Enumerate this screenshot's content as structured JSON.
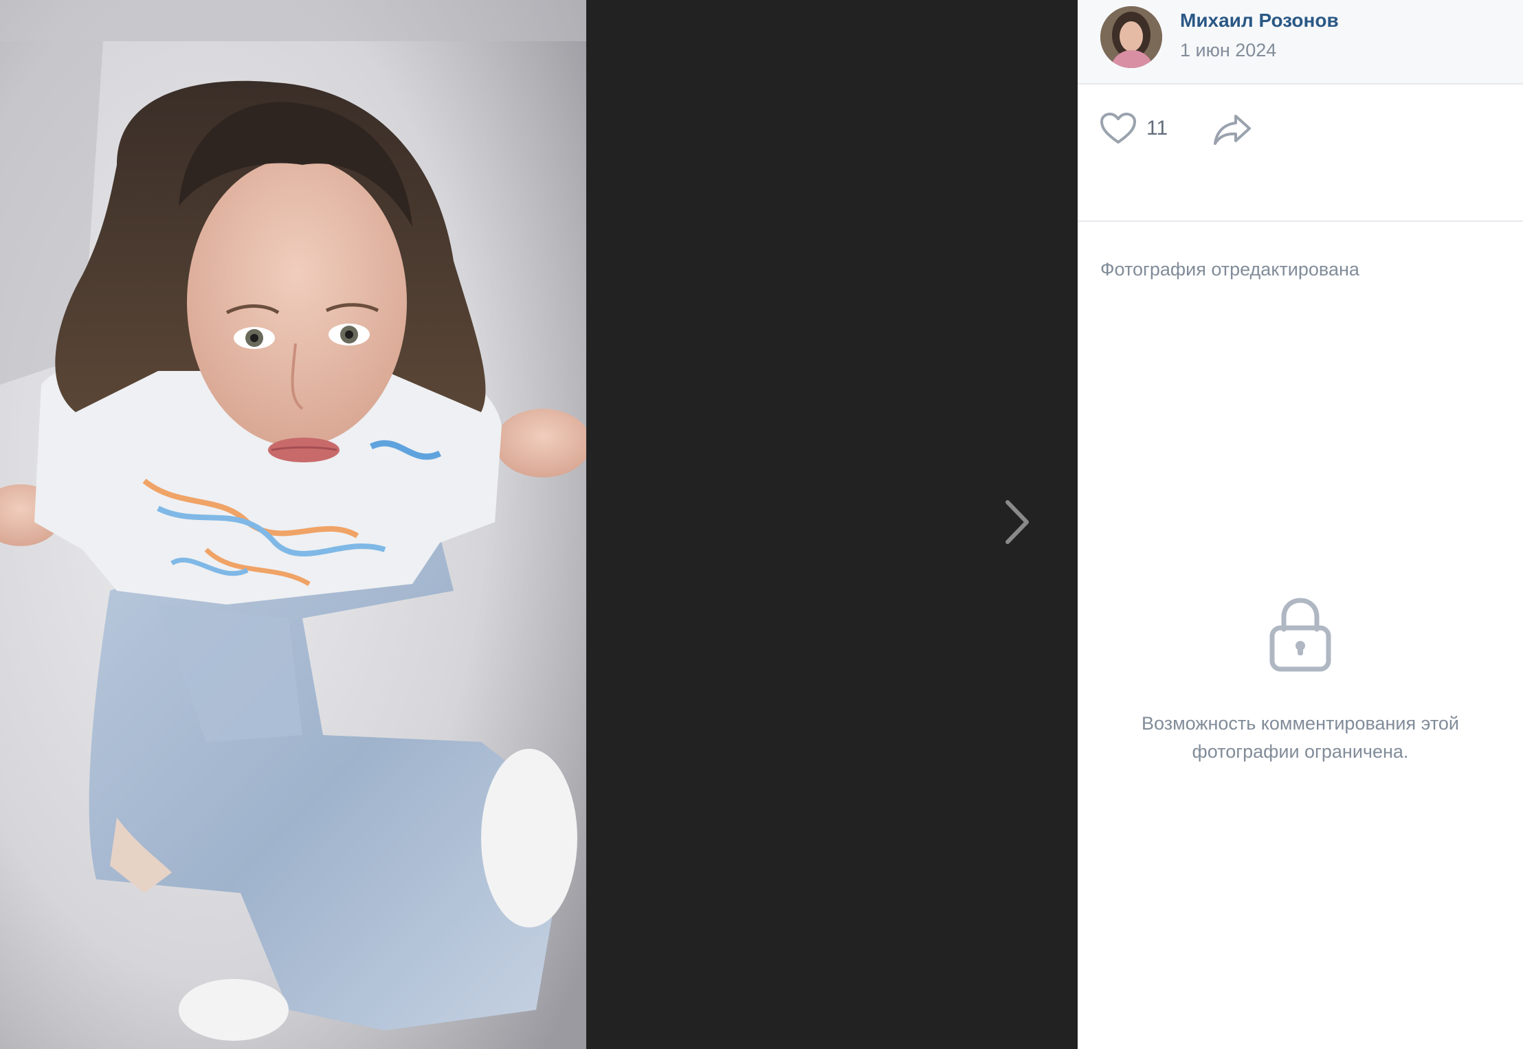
{
  "viewer": {
    "photo_alt": "photo",
    "next_icon": "chevron-right-icon"
  },
  "author": {
    "name": "Михаил Розонов",
    "date": "1 июн 2024"
  },
  "actions": {
    "like_count": "11",
    "like_icon": "heart-icon",
    "share_icon": "share-arrow-icon"
  },
  "photo_note": "Фотография отредактирована",
  "comments": {
    "locked_icon": "lock-icon",
    "locked_text": "Возможность комментирования этой фотографии ограничена."
  },
  "colors": {
    "viewer_bg": "#222222",
    "link": "#2a5885",
    "secondary_text": "#818c99",
    "icon": "#aeb7c2"
  }
}
